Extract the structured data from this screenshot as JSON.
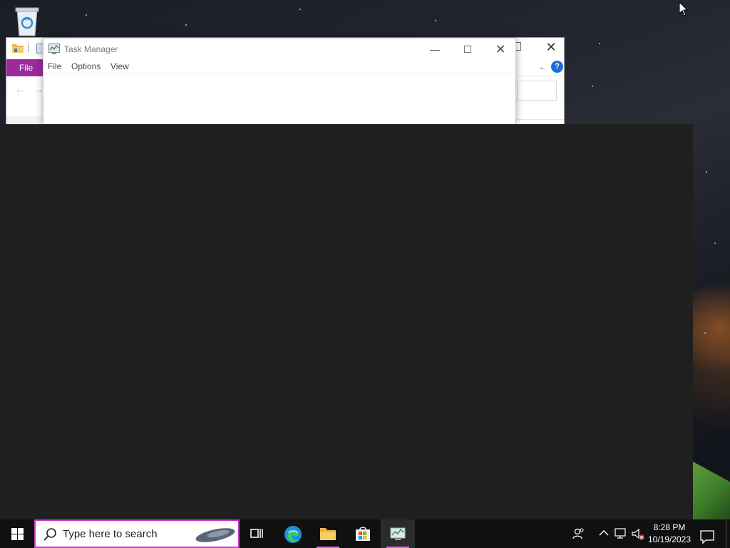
{
  "desktop": {
    "icons": [
      {
        "name": "recycle-bin"
      }
    ]
  },
  "explorer_window": {
    "file_tab_label": "File",
    "help_label": "?"
  },
  "task_manager": {
    "title": "Task Manager",
    "menu": [
      "File",
      "Options",
      "View"
    ]
  },
  "taskbar": {
    "search_placeholder": "Type here to search",
    "apps": [
      "task-view",
      "microsoft-edge",
      "file-explorer",
      "microsoft-store",
      "task-manager"
    ],
    "clock": {
      "time": "8:28 PM",
      "date": "10/19/2023"
    }
  },
  "colors": {
    "explorer_accent": "#9b2a9a",
    "search_border": "#c33dc6",
    "taskbar_bg": "#101010",
    "dark_pane": "#1f1f1f"
  }
}
